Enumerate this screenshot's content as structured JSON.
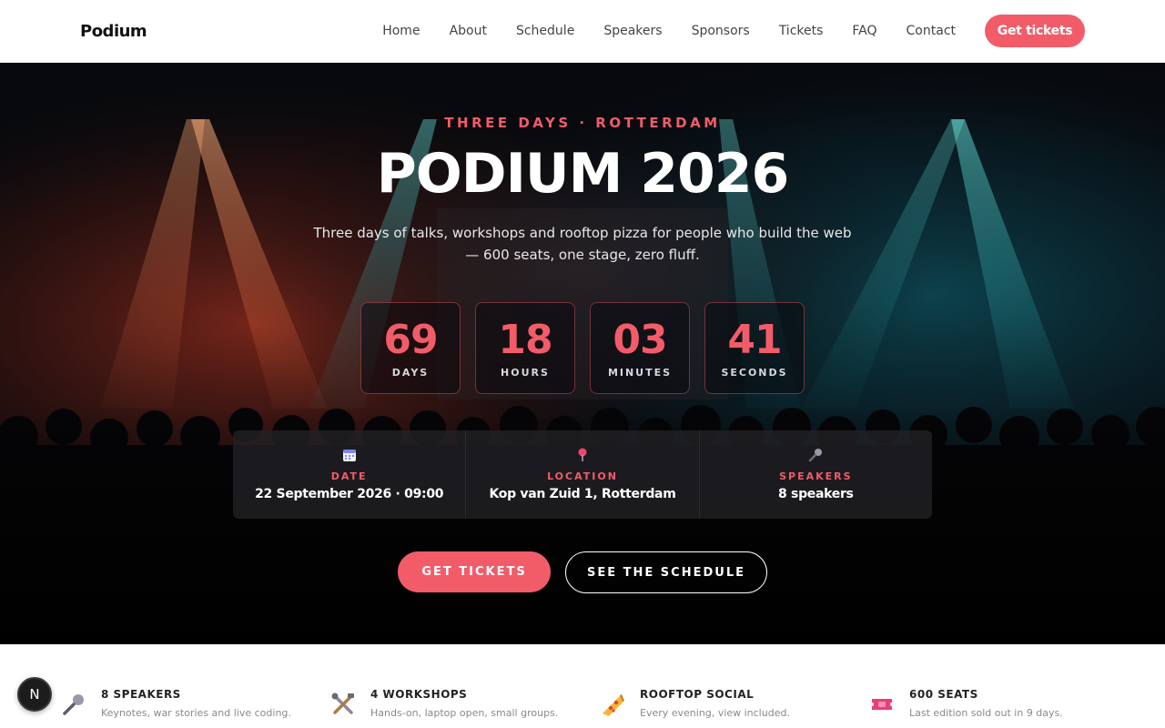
{
  "nav": {
    "brand": "Podium",
    "links": [
      "Home",
      "About",
      "Schedule",
      "Speakers",
      "Sponsors",
      "Tickets",
      "FAQ",
      "Contact"
    ],
    "cta": "Get tickets"
  },
  "hero": {
    "eyebrow": "THREE DAYS · ROTTERDAM",
    "title": "PODIUM 2026",
    "subtitle": "Three days of talks, workshops and rooftop pizza for people who build the web — 600 seats, one stage, zero fluff.",
    "countdown": [
      {
        "value": "69",
        "label": "DAYS"
      },
      {
        "value": "18",
        "label": "HOURS"
      },
      {
        "value": "03",
        "label": "MINUTES"
      },
      {
        "value": "41",
        "label": "SECONDS"
      }
    ],
    "info": [
      {
        "icon": "calendar-icon",
        "label": "DATE",
        "value": "22 September 2026 · 09:00"
      },
      {
        "icon": "location-pin-icon",
        "label": "LOCATION",
        "value": "Kop van Zuid 1, Rotterdam"
      },
      {
        "icon": "microphone-icon",
        "label": "SPEAKERS",
        "value": "8 speakers"
      }
    ],
    "primary_cta": "GET TICKETS",
    "secondary_cta": "SEE THE SCHEDULE"
  },
  "features": [
    {
      "icon": "microphone-icon",
      "title": "8 SPEAKERS",
      "desc": "Keynotes, war stories and live coding."
    },
    {
      "icon": "tools-icon",
      "title": "4 WORKSHOPS",
      "desc": "Hands-on, laptop open, small groups."
    },
    {
      "icon": "pizza-icon",
      "title": "ROOFTOP SOCIAL",
      "desc": "Every evening, view included."
    },
    {
      "icon": "ticket-icon",
      "title": "600 SEATS",
      "desc": "Last edition sold out in 9 days."
    }
  ],
  "fab": {
    "label": "N"
  },
  "colors": {
    "accent": "#f25c69",
    "hero_bg": "#07090d"
  }
}
